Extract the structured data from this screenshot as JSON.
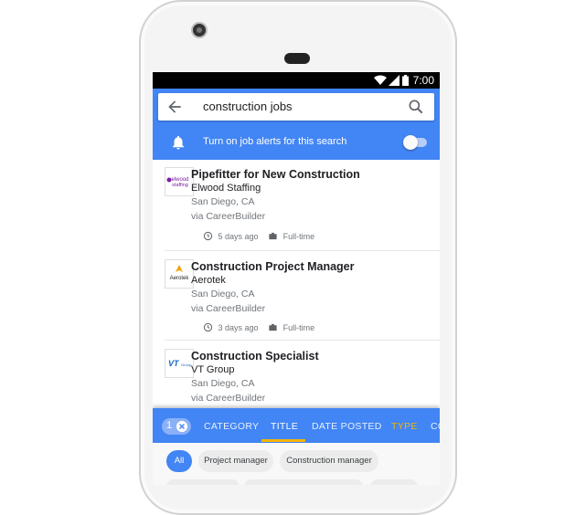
{
  "status_bar": {
    "time": "7:00",
    "icons": [
      "wifi-icon",
      "signal-icon",
      "battery-icon"
    ]
  },
  "search": {
    "query": "construction jobs",
    "back_icon": "arrow-back-icon",
    "search_icon": "search-icon"
  },
  "alerts": {
    "label": "Turn on job alerts for this search",
    "icon": "bell-icon",
    "enabled": false
  },
  "jobs": [
    {
      "logo_text": "Elwood Staffing",
      "title": "Pipefitter for New Construction",
      "company": "Elwood Staffing",
      "location": "San Diego, CA",
      "via": "via CareerBuilder",
      "posted": "5 days ago",
      "type": "Full-time"
    },
    {
      "logo_text": "Aerotek",
      "title": "Construction Project Manager",
      "company": "Aerotek",
      "location": "San Diego, CA",
      "via": "via CareerBuilder",
      "posted": "3 days ago",
      "type": "Full-time"
    },
    {
      "logo_text": "VT Group",
      "title": "Construction Specialist",
      "company": "VT Group",
      "location": "San Diego, CA",
      "via": "via CareerBuilder"
    }
  ],
  "filters": {
    "active_count": "1",
    "tabs": [
      "CATEGORY",
      "TITLE",
      "DATE POSTED",
      "TYPE",
      "CO"
    ],
    "selected_tab": "TITLE",
    "chips": [
      "All",
      "Project manager",
      "Construction manager"
    ],
    "selected_chip": "All"
  },
  "colors": {
    "primary": "#4285f4",
    "accent": "#f4b400",
    "type_tab": "#f4b400"
  }
}
